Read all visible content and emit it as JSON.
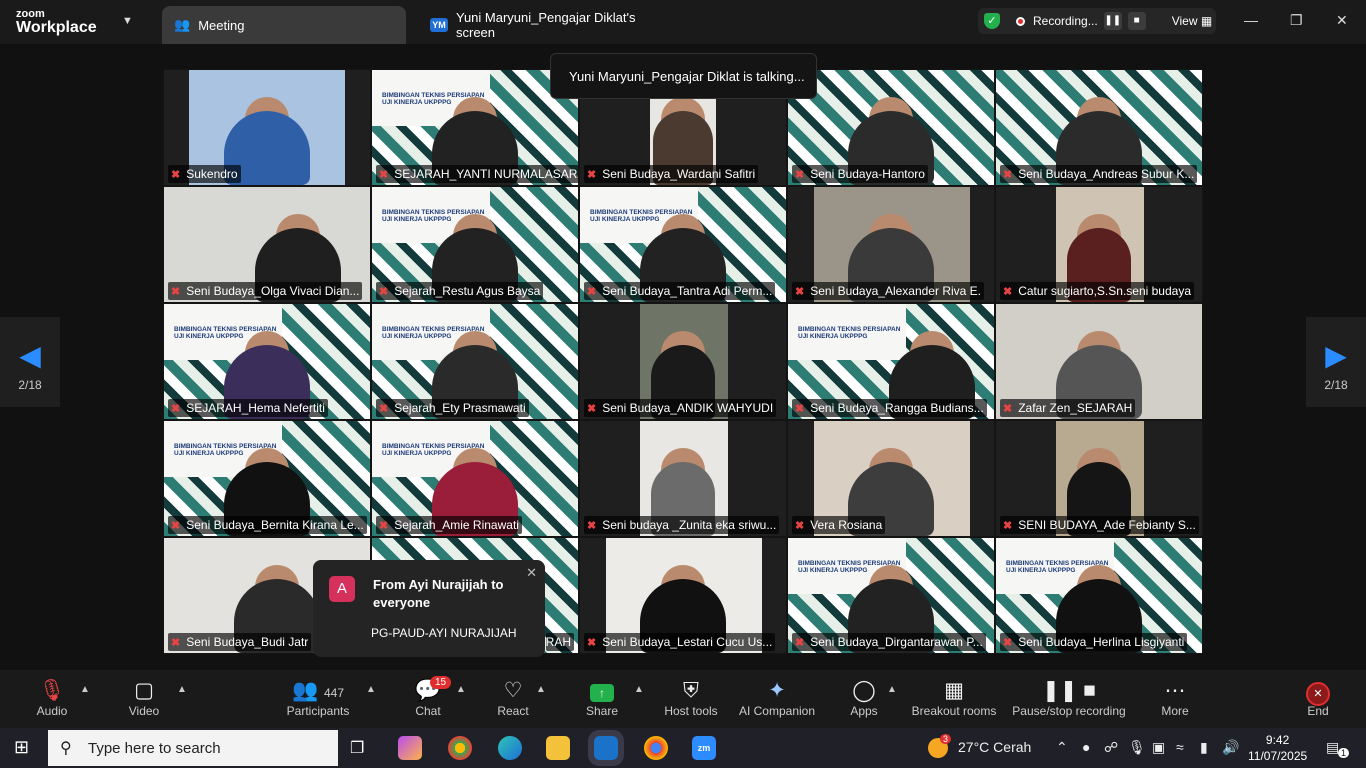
{
  "app": {
    "brand_top": "zoom",
    "brand_bottom": "Workplace"
  },
  "tabs": [
    {
      "label": "Meeting"
    },
    {
      "label": "Yuni Maryuni_Pengajar Diklat's screen",
      "initials": "YM"
    }
  ],
  "recording": {
    "label": "Recording...",
    "view_label": "View"
  },
  "talking_banner": "Yuni Maryuni_Pengajar Diklat is talking...",
  "pagination": {
    "left": "2/18",
    "right": "2/18"
  },
  "participants": [
    "Sukendro",
    "SEJARAH_YANTI NURMALASARI",
    "Seni Budaya_Wardani Safitri",
    "Seni Budaya-Hantoro",
    "Seni Budaya_Andreas Subur K...",
    "Seni Budaya_Olga Vivaci Dian...",
    "Sejarah_Restu Agus Baysa",
    "Seni Budaya_Tantra Adi Perm...",
    "Seni Budaya_Alexander Riva E.",
    "Catur sugiarto,S.Sn.seni budaya",
    "SEJARAH_Hema Nefertiti",
    "Sejarah_Ety Prasmawati",
    "Seni Budaya_ANDIK WAHYUDI",
    "Seni Budaya_Rangga Budians...",
    "Zafar Zen_SEJARAH",
    "Seni Budaya_Bernita Kirana Le...",
    "Sejarah_Amie Rinawati",
    "Seni budaya _Zunita eka sriwu...",
    "Vera Rosiana",
    "SENI BUDAYA_Ade Febianty S...",
    "Seni Budaya_Budi Jatr",
    "RAH",
    "Seni Budaya_Lestari Cucu Us...",
    "Seni Budaya_Dirgantarawan P...",
    "Seni Budaya_Herlina Lisgiyanti"
  ],
  "banner_text": "BIMBINGAN TEKNIS PERSIAPAN UJI KINERJA UKPPPG",
  "chat_notification": {
    "initial": "A",
    "title": "From Ayi Nurajijah to everyone",
    "message": "PG-PAUD-AYI NURAJIJAH"
  },
  "toolbar": {
    "audio": "Audio",
    "video": "Video",
    "participants": "Participants",
    "participants_count": "447",
    "chat": "Chat",
    "chat_badge": "15",
    "react": "React",
    "share": "Share",
    "host_tools": "Host tools",
    "ai_companion": "AI Companion",
    "apps": "Apps",
    "breakout": "Breakout rooms",
    "pause_recording": "Pause/stop recording",
    "more": "More",
    "end": "End"
  },
  "taskbar": {
    "search_placeholder": "Type here to search",
    "weather": "27°C  Cerah",
    "weather_badge": "3",
    "time": "9:42",
    "date": "11/07/2025",
    "notification_count": "1"
  }
}
